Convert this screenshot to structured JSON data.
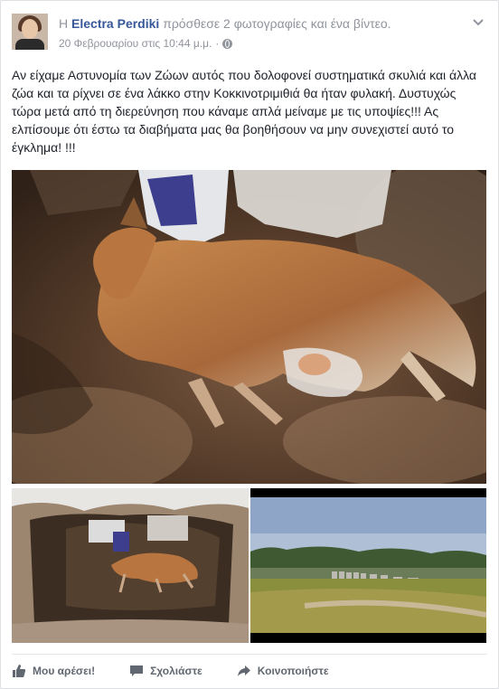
{
  "post": {
    "prefix": "Η",
    "author": "Electra Perdiki",
    "action": "πρόσθεσε 2 φωτογραφίες και ένα βίντεο.",
    "timestamp": "20 Φεβρουαρίου στις 10:44 μ.μ.",
    "separator": "·",
    "privacy_icon": "globe-icon",
    "menu_icon": "chevron-down-icon",
    "text": "Αν είχαμε Αστυνομία των Ζώων αυτός που δολοφονεί συστηματικά σκυλιά και άλλα ζώα και τα ρίχνει σε ένα λάκκο στην Κοκκινοτριμιθιά θα ήταν φυλακή. Δυστυχώς τώρα μετά από τη διερεύνηση που κάναμε απλά μείναμε με τις υποψίες!!! Ας ελπίσουμε ότι έστω τα διαβήματα μας θα βοηθήσουν να μην συνεχιστεί αυτό το έγκλημα! !!!"
  },
  "media": {
    "main_photo": "dead-dog-in-pit-photo",
    "photo_2": "dog-in-pit-wide-photo",
    "video": "field-landscape-video"
  },
  "actions": {
    "like": {
      "label": "Μου αρέσει!",
      "icon": "thumbs-up-icon"
    },
    "comment": {
      "label": "Σχολιάστε",
      "icon": "comment-icon"
    },
    "share": {
      "label": "Κοινοποιήστε",
      "icon": "share-icon"
    }
  },
  "colors": {
    "link": "#365899",
    "meta": "#90949c",
    "text": "#1d2129",
    "action": "#606770"
  }
}
